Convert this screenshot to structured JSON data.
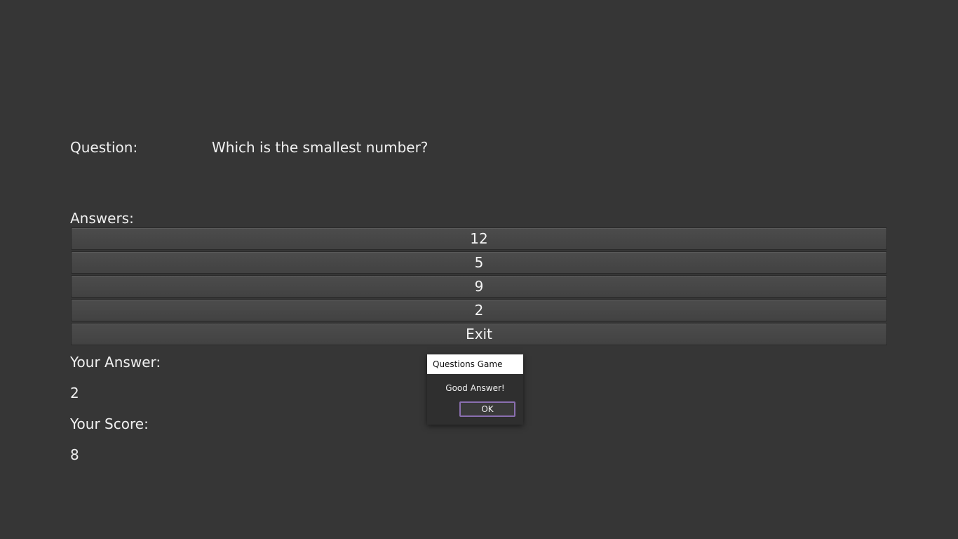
{
  "question": {
    "label": "Question:",
    "text": "Which is the smallest number?"
  },
  "answers": {
    "label": "Answers:",
    "options": [
      "12",
      "5",
      "9",
      "2"
    ],
    "exit_label": "Exit"
  },
  "result": {
    "your_answer_label": "Your Answer:",
    "your_answer_value": "2",
    "your_score_label": "Your Score:",
    "your_score_value": "8"
  },
  "dialog": {
    "title": "Questions Game",
    "message": "Good Answer!",
    "ok_label": "OK"
  },
  "colors": {
    "background": "#363636",
    "button": "#464646",
    "dialog_accent": "#8a6fb0"
  }
}
